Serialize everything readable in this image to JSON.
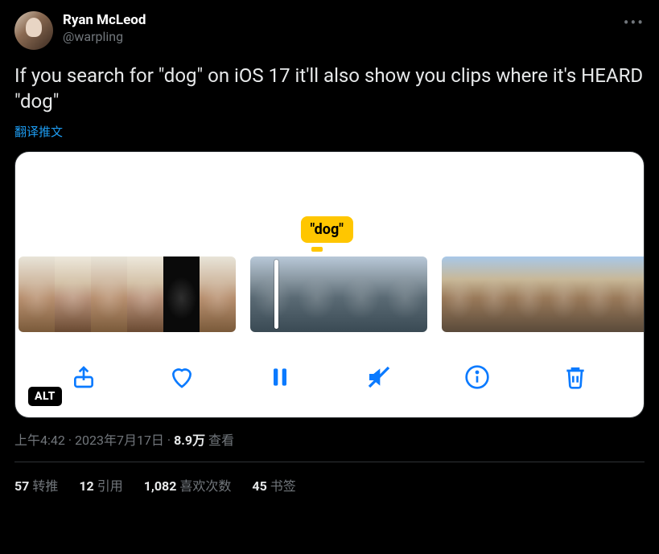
{
  "author": {
    "display_name": "Ryan McLeod",
    "handle": "@warpling"
  },
  "tweet_text": "If you search for \"dog\" on iOS 17 it'll also show you clips where it's HEARD \"dog\"",
  "translate_label": "翻译推文",
  "media": {
    "tooltip_text": "\"dog\"",
    "alt_badge": "ALT"
  },
  "meta": {
    "time": "上午4:42",
    "dot": " · ",
    "date": "2023年7月17日",
    "views_count": "8.9万",
    "views_label": " 查看"
  },
  "stats": {
    "retweets_count": "57",
    "retweets_label": "转推",
    "quotes_count": "12",
    "quotes_label": "引用",
    "likes_count": "1,082",
    "likes_label": "喜欢次数",
    "bookmarks_count": "45",
    "bookmarks_label": "书签"
  }
}
